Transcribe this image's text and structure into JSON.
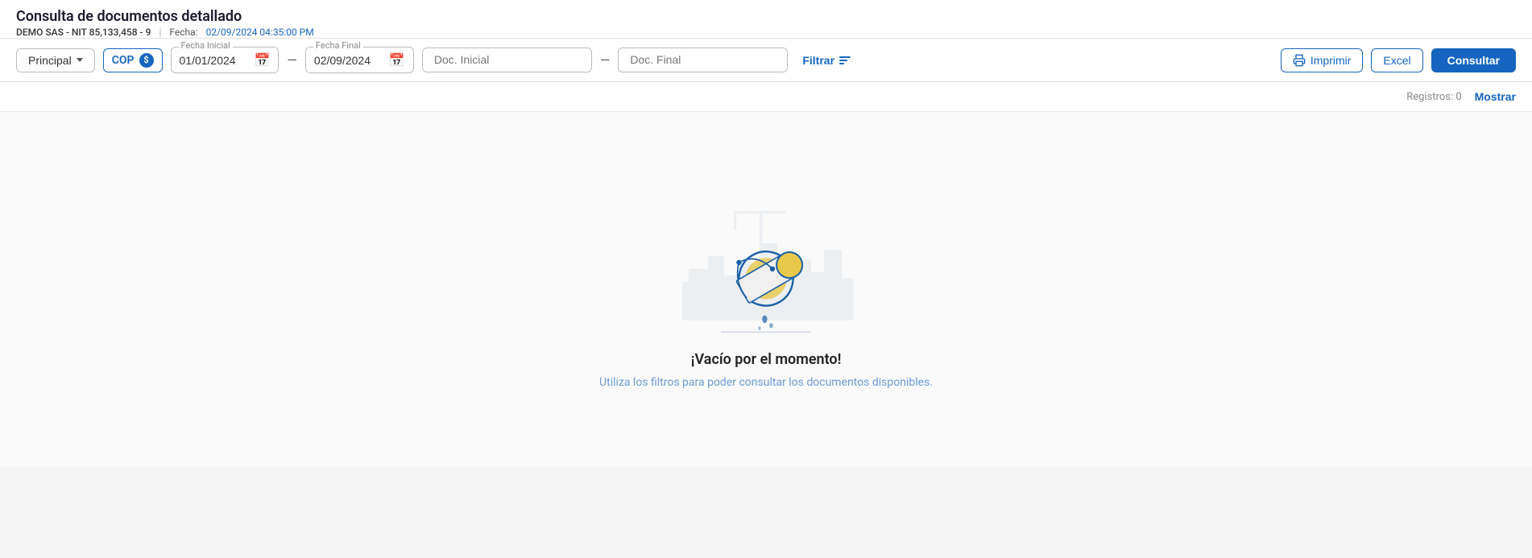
{
  "page": {
    "title": "Consulta de documentos detallado",
    "company": "DEMO SAS - NIT 85,133,458 - 9",
    "date_label": "Fecha:",
    "date_value": "02/09/2024 04:35:00 PM"
  },
  "toolbar": {
    "principal_label": "Principal",
    "cop_label": "COP",
    "fecha_inicial_label": "Fecha Inicial",
    "fecha_inicial_value": "01/01/2024",
    "fecha_final_label": "Fecha Final",
    "fecha_final_value": "02/09/2024",
    "doc_inicial_placeholder": "Doc. Inicial",
    "doc_final_placeholder": "Doc. Final",
    "filtrar_label": "Filtrar",
    "imprimir_label": "Imprimir",
    "excel_label": "Excel",
    "consultar_label": "Consultar"
  },
  "results_bar": {
    "registros_label": "Registros: 0",
    "mostrar_label": "Mostrar"
  },
  "empty_state": {
    "title": "¡Vacío por el momento!",
    "subtitle": "Utiliza los filtros para poder consultar los documentos disponibles."
  }
}
